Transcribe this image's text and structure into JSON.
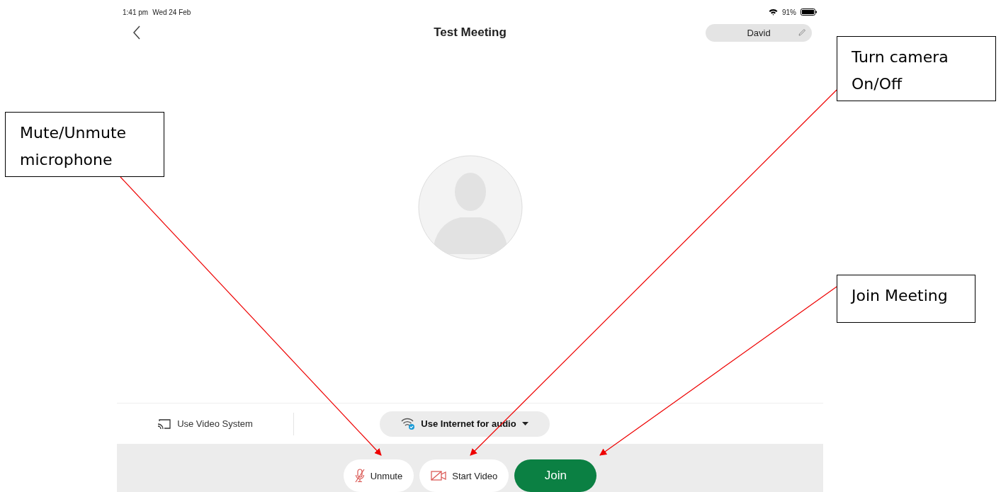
{
  "status_bar": {
    "time": "1:41 pm",
    "date": "Wed 24 Feb",
    "battery": "91%"
  },
  "header": {
    "title": "Test Meeting",
    "user_name": "David"
  },
  "bottom_bar": {
    "video_system_label": "Use Video System",
    "audio_button": "Use Internet for audio"
  },
  "actions": [
    {
      "kind": "mic",
      "label": "Unmute"
    },
    {
      "kind": "video",
      "label": "Start Video"
    },
    {
      "kind": "join",
      "label": "Join"
    }
  ],
  "callouts": [
    {
      "text": "Mute/Unmute microphone"
    },
    {
      "text": "Turn camera On/Off"
    },
    {
      "text": "Join Meeting"
    }
  ]
}
